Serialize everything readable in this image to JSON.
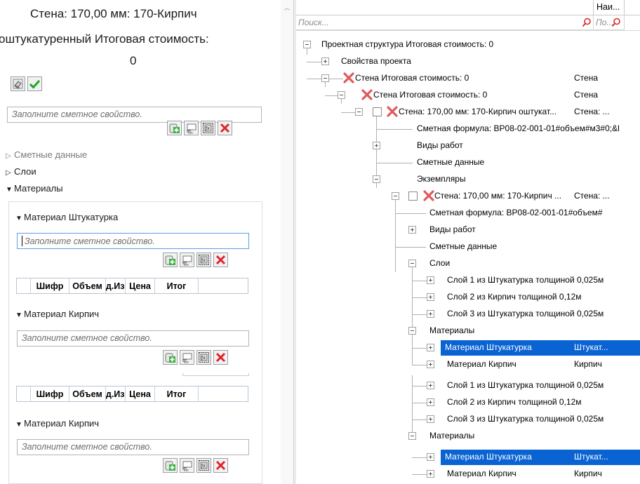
{
  "left": {
    "title_line1": "Стена: 170,00 мм: 170-Кирпич",
    "title_line2": "оштукатуренный Итоговая стоимость:",
    "title_line3": "0",
    "main_input_placeholder": "Заполните сметное свойство.",
    "sections": [
      {
        "label": "Сметные данные",
        "state": "collapsed"
      },
      {
        "label": "Слои",
        "state": "collapsed"
      },
      {
        "label": "Материалы",
        "state": "expanded"
      }
    ],
    "materials": [
      {
        "title": "Материал Штукатурка",
        "placeholder": "Заполните сметное свойство."
      },
      {
        "title": "Материал Кирпич",
        "placeholder": "Заполните сметное свойство."
      },
      {
        "title": "Материал Кирпич",
        "placeholder": "Заполните сметное свойство."
      }
    ],
    "grid_columns": [
      "Шифр",
      "Объем",
      "Ед.Изм",
      "Цена",
      "Итог"
    ]
  },
  "right": {
    "column_headers": [
      "",
      "Наи..."
    ],
    "filter_placeholders": [
      "Поиск...",
      "По..."
    ],
    "tree": [
      {
        "label": "Проектная структура Итоговая стоимость: 0",
        "col2": ""
      },
      {
        "label": "Свойства проекта",
        "col2": ""
      },
      {
        "label": "Стена Итоговая стоимость: 0",
        "col2": "Стена"
      },
      {
        "label": "Стена Итоговая стоимость: 0",
        "col2": "Стена"
      },
      {
        "label": "Стена: 170,00 мм: 170-Кирпич оштукат...",
        "col2": "Стена: ..."
      },
      {
        "label": "Сметная формула: ВР08-02-001-01#объем#м3#0;&l",
        "col2": ""
      },
      {
        "label": "Виды работ",
        "col2": ""
      },
      {
        "label": "Сметные данные",
        "col2": ""
      },
      {
        "label": "Экземпляры",
        "col2": ""
      },
      {
        "label": "Стена: 170,00 мм: 170-Кирпич ...",
        "col2": "Стена: ..."
      },
      {
        "label": "Сметная формула: ВР08-02-001-01#объем#",
        "col2": ""
      },
      {
        "label": "Виды работ",
        "col2": ""
      },
      {
        "label": "Сметные данные",
        "col2": ""
      },
      {
        "label": "Слои",
        "col2": ""
      },
      {
        "label": "Слой 1 из Штукатурка толщиной 0,025м",
        "col2": ""
      },
      {
        "label": "Слой 2 из Кирпич толщиной 0,12м",
        "col2": ""
      },
      {
        "label": "Слой 3 из Штукатурка толщиной 0,025м",
        "col2": ""
      },
      {
        "label": "Материалы",
        "col2": ""
      },
      {
        "label": "Материал Штукатурка",
        "col2": "Штукат..."
      },
      {
        "label": "Материал Кирпич",
        "col2": "Кирпич"
      },
      {
        "label": "Слой 1 из Штукатурка толщиной 0,025м",
        "col2": ""
      },
      {
        "label": "Слой 2 из Кирпич толщиной 0,12м",
        "col2": ""
      },
      {
        "label": "Слой 3 из Штукатурка толщиной 0,025м",
        "col2": ""
      },
      {
        "label": "Материалы",
        "col2": ""
      },
      {
        "label": "Материал Штукатурка",
        "col2": "Штукат..."
      },
      {
        "label": "Материал Кирпич",
        "col2": "Кирпич"
      }
    ]
  },
  "colors": {
    "selection": "#0a63d2",
    "delete_red": "#e0242b",
    "apply_green": "#1fa61f",
    "add_green": "#3cb043"
  },
  "icons": [
    "eraser-icon",
    "check-icon",
    "add-icon",
    "rename-icon",
    "formula-icon",
    "delete-icon",
    "search-icon",
    "error-x-icon"
  ]
}
